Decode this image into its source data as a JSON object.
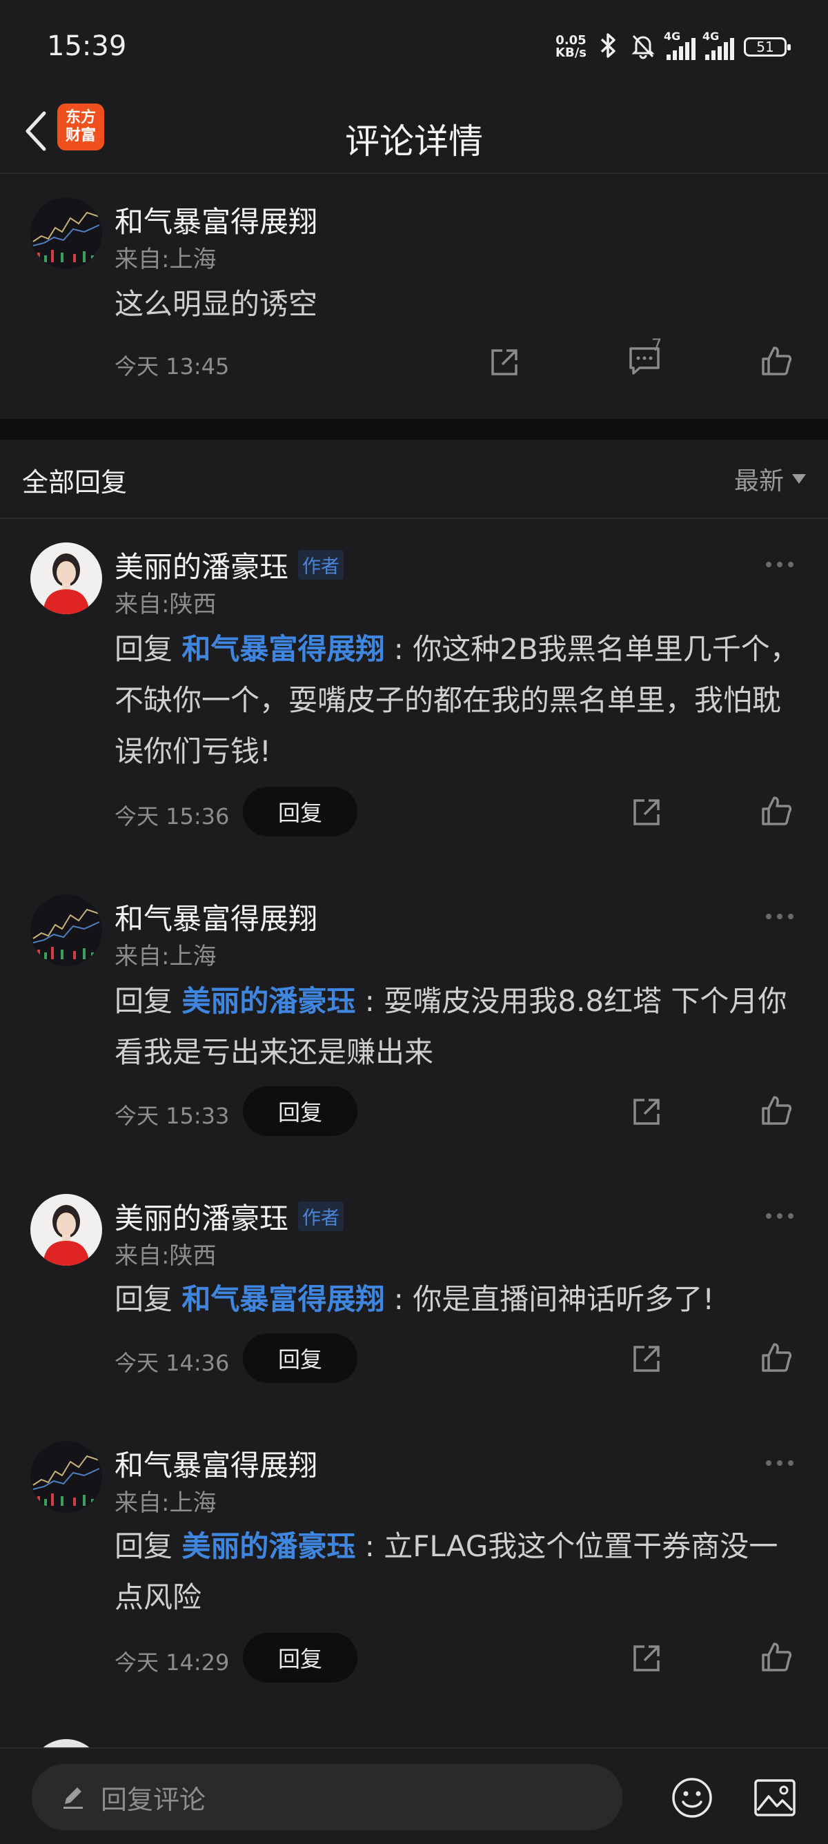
{
  "status_bar": {
    "time": "15:39",
    "net_speed_value": "0.05",
    "net_speed_unit": "KB/s",
    "signal_1_label": "4G",
    "signal_2_label": "4G",
    "battery": "51"
  },
  "nav": {
    "back_icon": "chevron-left-icon",
    "logo_line1": "东方",
    "logo_line2": "财富",
    "title": "评论详情"
  },
  "main_comment": {
    "user": "和气暴富得展翔",
    "location": "来自:上海",
    "text": "这么明显的诱空",
    "time": "今天 13:45",
    "comment_count": "7"
  },
  "replies_header": {
    "title": "全部回复",
    "sort": "最新"
  },
  "replies": [
    {
      "user": "美丽的潘豪珏",
      "tag": "作者",
      "location": "来自:陕西",
      "reply_prefix": "回复",
      "mention": "和气暴富得展翔",
      "text_line1": ": 你这种2B我黑名单里几千",
      "text_rest": "个，不缺你一个，耍嘴皮子的都在我的黑名单里，我怕耽误你们亏钱!",
      "time": "今天 15:36",
      "reply_button": "回复"
    },
    {
      "user": "和气暴富得展翔",
      "tag": "",
      "location": "来自:上海",
      "reply_prefix": "回复",
      "mention": "美丽的潘豪珏",
      "text_line1": ": 耍嘴皮没用我8.8红塔  下个",
      "text_rest": "月你看我是亏出来还是赚出来",
      "time": "今天 15:33",
      "reply_button": "回复"
    },
    {
      "user": "美丽的潘豪珏",
      "tag": "作者",
      "location": "来自:陕西",
      "reply_prefix": "回复",
      "mention": "和气暴富得展翔",
      "text_line1": ": 你是直播间神话听多了!",
      "text_rest": "",
      "time": "今天 14:36",
      "reply_button": "回复"
    },
    {
      "user": "和气暴富得展翔",
      "tag": "",
      "location": "来自:上海",
      "reply_prefix": "回复",
      "mention": "美丽的潘豪珏",
      "text_line1": ": 立FLAG我这个位置干券商没",
      "text_rest": "一点风险",
      "time": "今天 14:29",
      "reply_button": "回复"
    }
  ],
  "bottom_bar": {
    "placeholder": "回复评论",
    "emoji_icon": "emoji-icon",
    "image_icon": "image-icon"
  },
  "colors": {
    "background": "#1c1c1e",
    "mention": "#3f86e0",
    "logo": "#f0501e",
    "author_tag": "#4a86d8"
  }
}
